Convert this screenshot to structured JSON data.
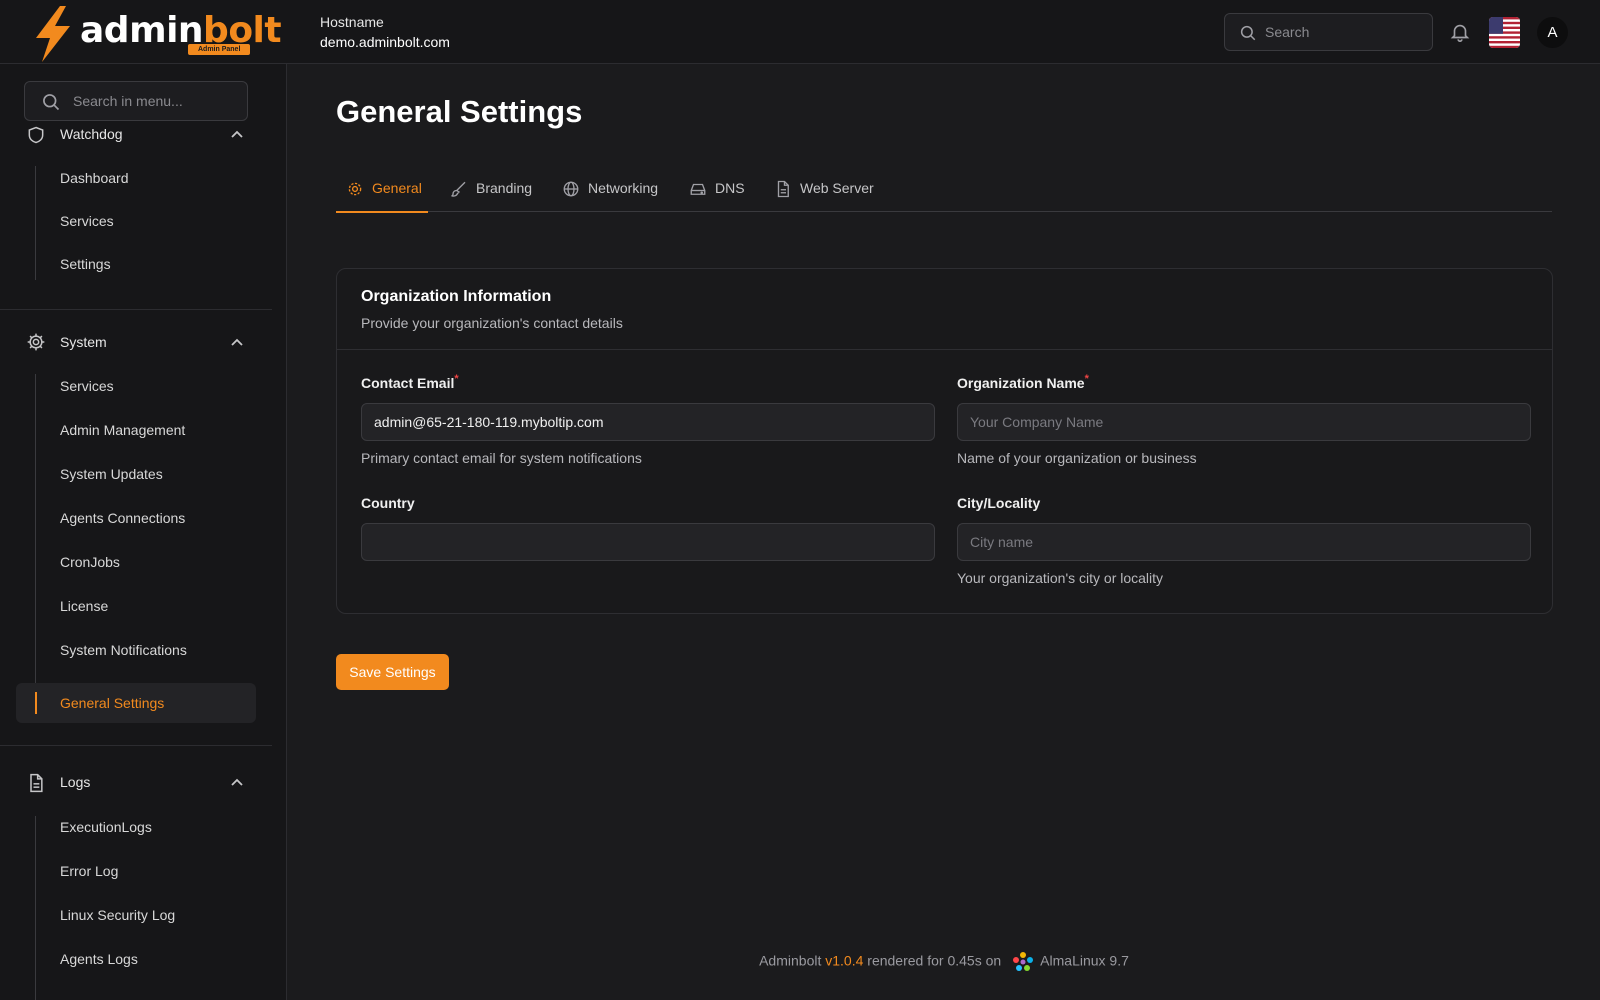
{
  "header": {
    "logo": {
      "word_admin": "admin",
      "word_bolt": "bolt",
      "badge": "Admin Panel"
    },
    "hostname_label": "Hostname",
    "hostname_value": "demo.adminbolt.com",
    "search_placeholder": "Search",
    "avatar_initial": "A",
    "language_flag": "us-flag-icon"
  },
  "sidebar": {
    "search_placeholder": "Search in menu...",
    "groups": [
      {
        "label": "Watchdog",
        "icon": "shield-icon",
        "items": [
          "Dashboard",
          "Services",
          "Settings"
        ]
      },
      {
        "label": "System",
        "icon": "gear-icon",
        "items": [
          "Services",
          "Admin Management",
          "System Updates",
          "Agents Connections",
          "CronJobs",
          "License",
          "System Notifications",
          "General Settings"
        ],
        "active_item": "General Settings"
      },
      {
        "label": "Logs",
        "icon": "document-icon",
        "items": [
          "ExecutionLogs",
          "Error Log",
          "Linux Security Log",
          "Agents Logs"
        ]
      }
    ]
  },
  "main": {
    "title": "General Settings",
    "tabs": [
      {
        "label": "General",
        "icon": "gear-icon",
        "active": true
      },
      {
        "label": "Branding",
        "icon": "brush-icon",
        "active": false
      },
      {
        "label": "Networking",
        "icon": "globe-icon",
        "active": false
      },
      {
        "label": "DNS",
        "icon": "server-drive-icon",
        "active": false
      },
      {
        "label": "Web Server",
        "icon": "document-icon",
        "active": false
      }
    ],
    "card": {
      "title": "Organization Information",
      "description": "Provide your organization's contact details",
      "fields": {
        "contact_email": {
          "label": "Contact Email",
          "required_mark": "*",
          "value": "admin@65-21-180-119.myboltip.com",
          "help": "Primary contact email for system notifications"
        },
        "organization_name": {
          "label": "Organization Name",
          "required_mark": "*",
          "placeholder": "Your Company Name",
          "help": "Name of your organization or business"
        },
        "country": {
          "label": "Country",
          "value": ""
        },
        "city": {
          "label": "City/Locality",
          "placeholder": "City name",
          "help": "Your organization's city or locality"
        }
      }
    },
    "save_label": "Save Settings"
  },
  "footer": {
    "brand": "Adminbolt",
    "version": "v1.0.4",
    "rendered": "rendered for 0.45s on",
    "os": "AlmaLinux 9.7"
  },
  "colors": {
    "accent": "#f28a1e",
    "background": "#1b1b1d",
    "sidebar_bg": "#161618",
    "required": "#ef4444"
  }
}
